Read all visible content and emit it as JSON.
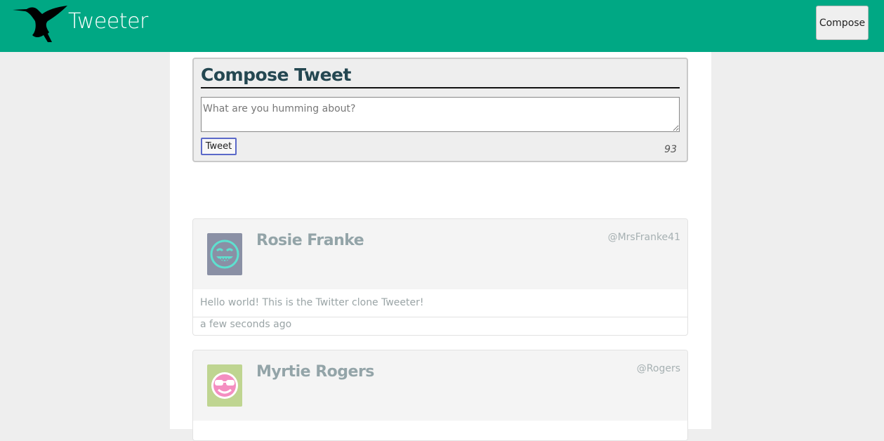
{
  "header": {
    "brand": "Tweeter",
    "compose_button": "Compose",
    "logo_icon": "hummingbird-icon"
  },
  "compose": {
    "title": "Compose Tweet",
    "placeholder": "What are you humming about?",
    "submit_label": "Tweet",
    "char_count": "93"
  },
  "tweets": [
    {
      "name": "Rosie Franke",
      "handle": "@MrsFranke41",
      "body": "Hello world! This is the Twitter clone Tweeter!",
      "time": "a few seconds ago",
      "avatar_icon": "grinning-face-avatar-icon",
      "avatar_colors": {
        "bg": "#8a90a5",
        "face": "#5ee0cf"
      }
    },
    {
      "name": "Myrtie Rogers",
      "handle": "@Rogers",
      "body": "",
      "time": "",
      "avatar_icon": "sunglasses-face-avatar-icon",
      "avatar_colors": {
        "bg": "#bfd591",
        "face": "#f48ec1"
      }
    }
  ],
  "colors": {
    "navbar": "#00a884",
    "compose_title": "#244751",
    "tweet_name": "#93a4a8"
  }
}
